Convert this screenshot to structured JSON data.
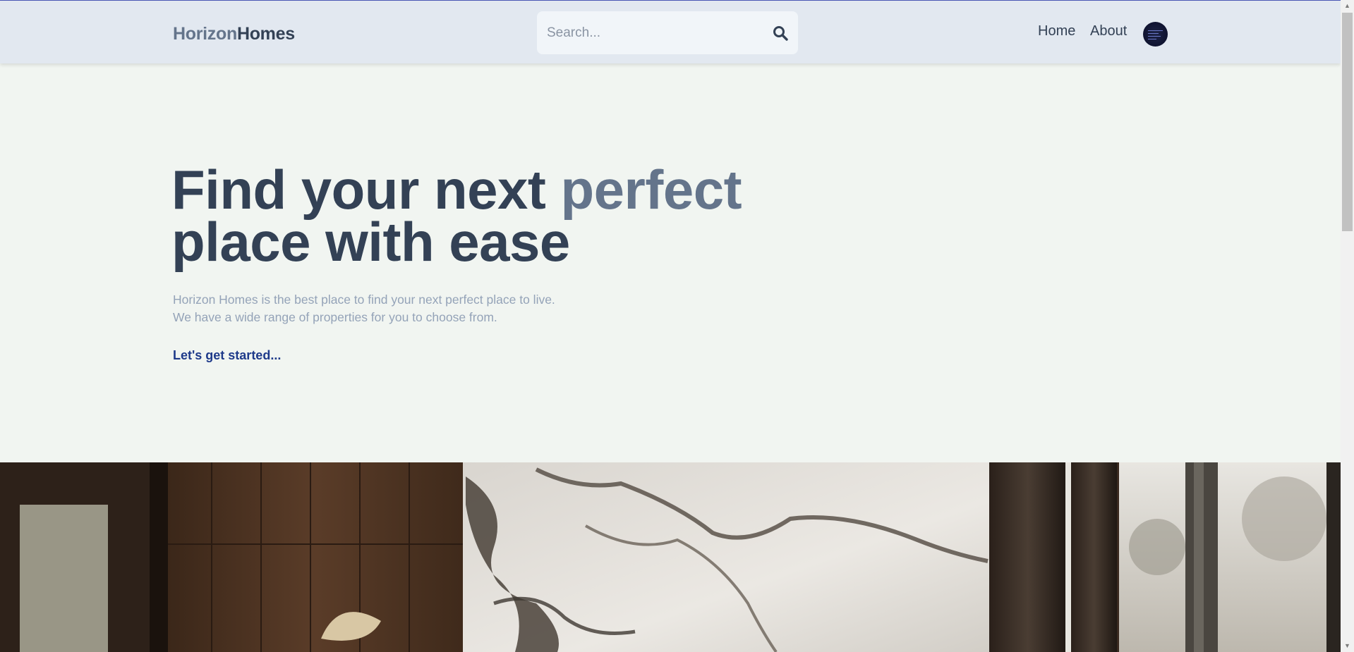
{
  "brand": {
    "part1": "Horizon",
    "part2": "Homes"
  },
  "search": {
    "placeholder": "Search...",
    "value": "",
    "icon": "search-icon"
  },
  "nav": {
    "home": "Home",
    "about": "About"
  },
  "hero": {
    "title_part1": "Find your next ",
    "title_accent": "perfect",
    "title_part2": "place with ease",
    "desc_line1": "Horizon Homes is the best place to find your next perfect place to live.",
    "desc_line2": "We have a wide range of properties for you to choose from.",
    "cta": "Let's get started..."
  },
  "colors": {
    "header_bg": "#e2e8f0",
    "page_bg": "#f1f5f1",
    "text_dark": "#334155",
    "text_muted": "#64748b",
    "cta": "#1e3a8a"
  }
}
